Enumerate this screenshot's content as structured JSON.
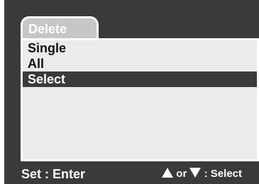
{
  "menu": {
    "tab_label": "Delete",
    "items": [
      {
        "label": "Single",
        "selected": false
      },
      {
        "label": "All",
        "selected": false
      },
      {
        "label": "Select",
        "selected": true
      }
    ]
  },
  "footer": {
    "set_hint": "Set : Enter",
    "or_text": "or",
    "select_text": ": Select",
    "up_icon": "up-triangle-icon",
    "down_icon": "down-triangle-icon"
  },
  "colors": {
    "background": "#3a3a3a",
    "panel": "#ebebeb",
    "tab": "#c6c6c6",
    "highlight": "#3a3a3a",
    "text_dark": "#111111",
    "text_light": "#ffffff"
  }
}
